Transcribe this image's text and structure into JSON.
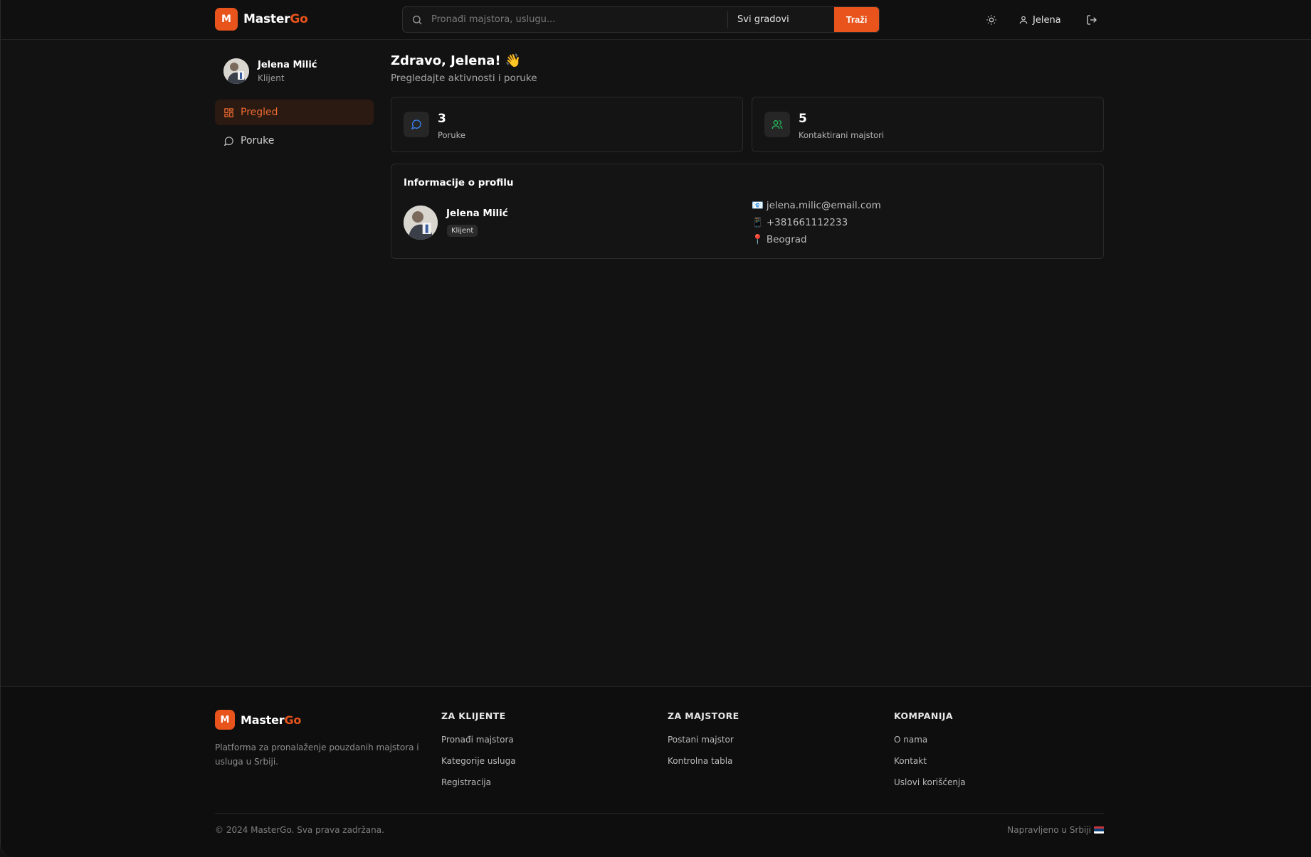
{
  "header": {
    "logo_letter": "M",
    "logo_master": "Master",
    "logo_go": "Go",
    "search_placeholder": "Pronađi majstora, uslugu...",
    "city_select": "Svi gradovi",
    "search_button": "Traži",
    "user_name": "Jelena"
  },
  "sidebar": {
    "profile_name": "Jelena Milić",
    "profile_role": "Klijent",
    "items": [
      {
        "label": "Pregled",
        "active": true,
        "icon": "dashboard-icon"
      },
      {
        "label": "Poruke",
        "active": false,
        "icon": "message-icon"
      }
    ]
  },
  "main": {
    "greeting": "Zdravo, Jelena! 👋",
    "subtitle": "Pregledajte aktivnosti i poruke",
    "stats": [
      {
        "value": "3",
        "label": "Poruke",
        "icon": "message-icon",
        "color": "#3b82f6"
      },
      {
        "value": "5",
        "label": "Kontaktirani majstori",
        "icon": "users-icon",
        "color": "#22c55e"
      }
    ],
    "profile_info": {
      "title": "Informacije o profilu",
      "name": "Jelena Milić",
      "role_badge": "Klijent",
      "email": "jelena.milic@email.com",
      "phone": "+381661112233",
      "city": "Beograd"
    }
  },
  "footer": {
    "logo_letter": "M",
    "logo_master": "Master",
    "logo_go": "Go",
    "description": "Platforma za pronalaženje pouzdanih majstora i usluga u Srbiji.",
    "columns": [
      {
        "heading": "ZA KLIJENTE",
        "links": [
          "Pronađi majstora",
          "Kategorije usluga",
          "Registracija"
        ]
      },
      {
        "heading": "ZA MAJSTORE",
        "links": [
          "Postani majstor",
          "Kontrolna tabla"
        ]
      },
      {
        "heading": "KOMPANIJA",
        "links": [
          "O nama",
          "Kontakt",
          "Uslovi korišćenja"
        ]
      }
    ],
    "copyright": "© 2024 MasterGo. Sva prava zadržana.",
    "made_in": "Napravljeno u Srbiji"
  },
  "colors": {
    "accent": "#e8541c",
    "background": "#121212"
  }
}
